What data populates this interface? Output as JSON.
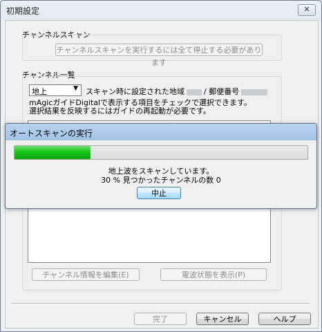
{
  "window": {
    "title": "初期設定",
    "close_label": "✕"
  },
  "scan_group": {
    "label": "チャンネルスキャン",
    "button_label": "チャンネルスキャンを実行するには全て停止する必要があります"
  },
  "list_group": {
    "label": "チャンネル一覧",
    "band_select": "地上",
    "region_prefix": "スキャン時に設定された地域",
    "postal_prefix": "/ 郵便番号",
    "info_line1": "mAgicガイドDigitalで表示する項目をチェックで選択できます。",
    "info_line2": "選択結果を反映するにはガイドの再起動が必要です。",
    "edit_button": "チャンネル情報を編集(E)",
    "signal_button": "電波状態を表示(P)"
  },
  "footer": {
    "done": "完了",
    "cancel": "キャンセル",
    "help": "ヘルプ"
  },
  "progress_dialog": {
    "title": "オートスキャンの実行",
    "progress": 0.26,
    "status_line1": "地上波をスキャンしています。",
    "status_line2": "30 % 見つかったチャンネルの数 0",
    "stop_button": "中止"
  },
  "colors": {
    "progress_green": "#16c916",
    "titlebar": "#a4c3e6"
  }
}
